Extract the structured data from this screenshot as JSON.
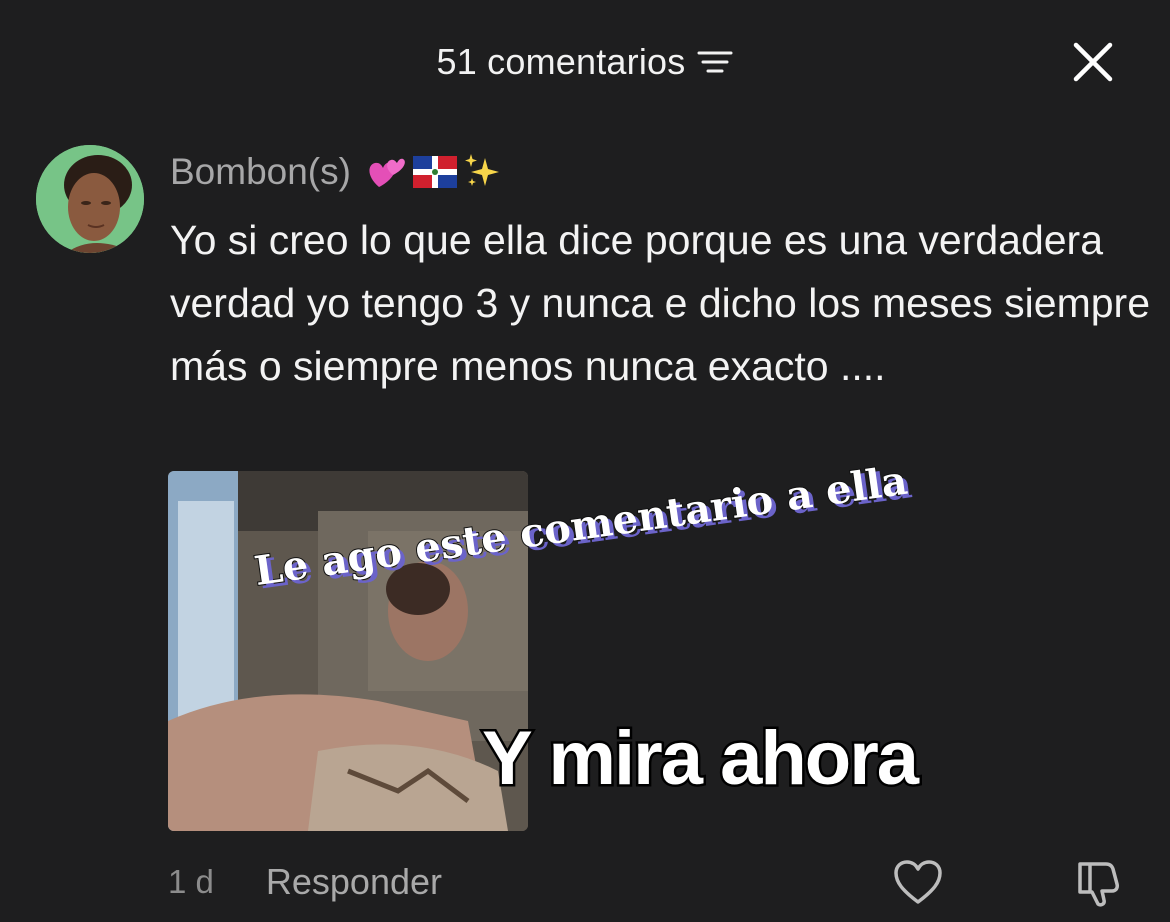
{
  "header": {
    "title": "51 comentarios",
    "filter_icon": "sort-filter-icon",
    "close_icon": "close-icon"
  },
  "comment": {
    "username": "Bombon(s)",
    "badges": [
      "two-hearts-emoji",
      "dominican-flag-emoji",
      "sparkles-emoji"
    ],
    "text": "Yo si creo lo que ella dice porque es una verdadera verdad yo tengo 3 y nunca e dicho los meses siempre más o siempre menos nunca exacto ....",
    "media": {
      "overlay_text_1": "Le ago este comentario a ella",
      "overlay_text_2": "Y mira ahora"
    },
    "timestamp": "1 d",
    "reply_label": "Responder",
    "like_icon": "heart-icon",
    "dislike_icon": "thumbs-down-icon"
  },
  "colors": {
    "background": "#1e1e1f",
    "username": "#a7a7a8",
    "text": "#f3f3f3",
    "meta": "#8c8c8c",
    "overlay_shadow": "#6b63c9"
  }
}
